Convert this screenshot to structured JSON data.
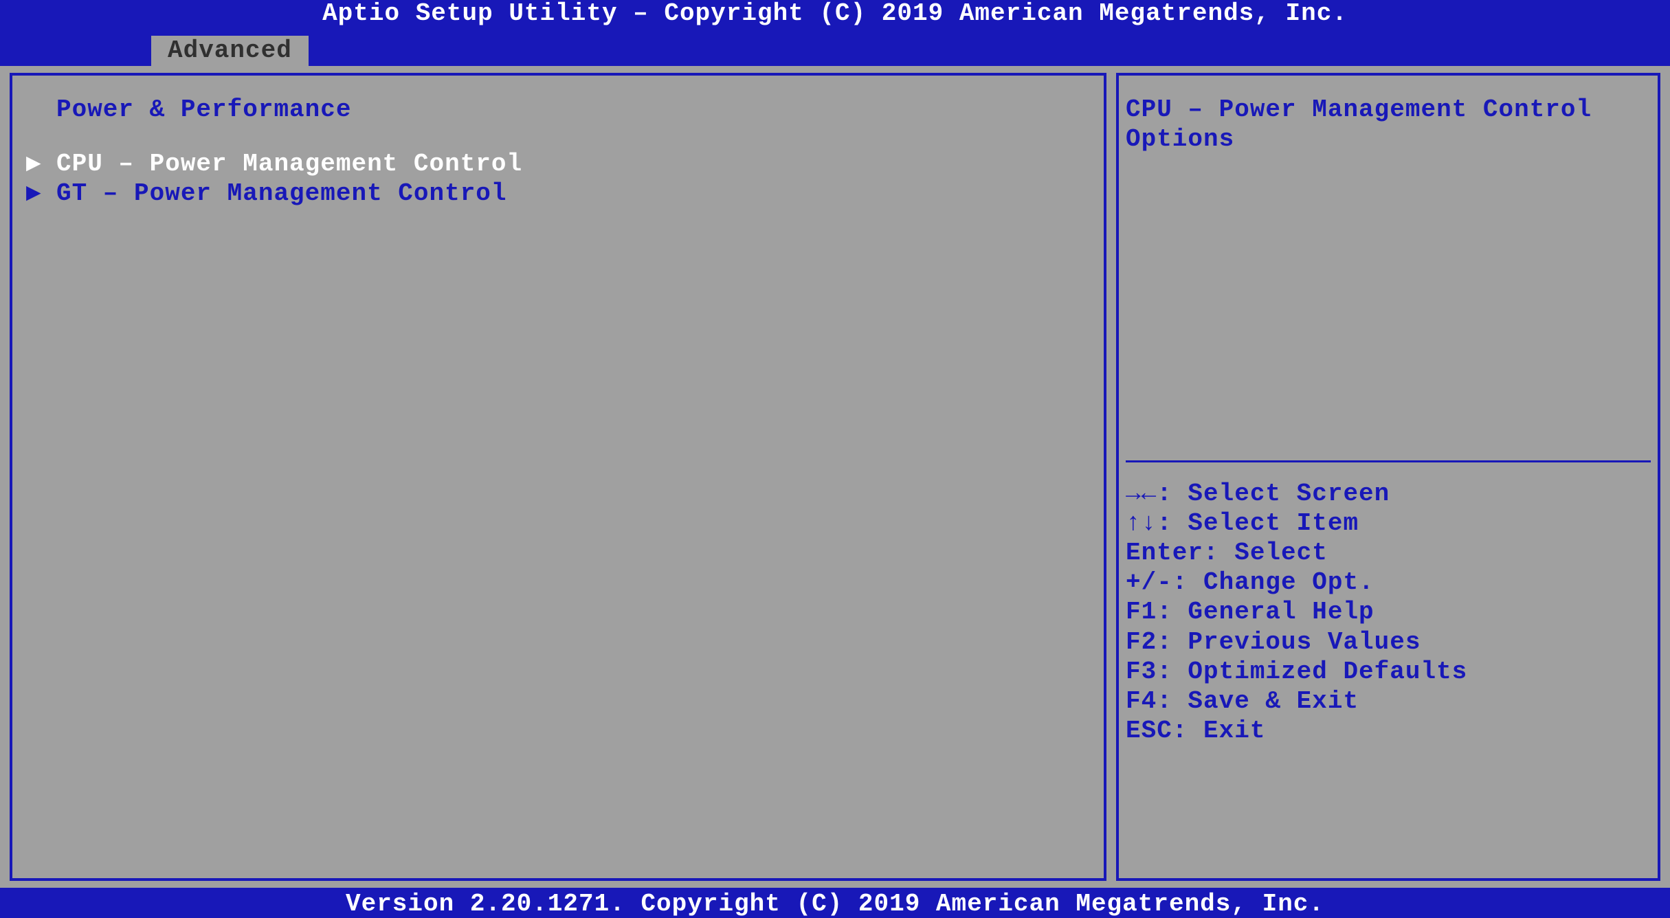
{
  "header": {
    "title": "Aptio Setup Utility – Copyright (C) 2019 American Megatrends, Inc."
  },
  "tabs": {
    "active": "Advanced"
  },
  "content": {
    "title": "Power & Performance",
    "items": [
      {
        "label": "CPU – Power Management Control",
        "selected": true
      },
      {
        "label": "GT – Power Management Control",
        "selected": false
      }
    ]
  },
  "help": {
    "description_line1": "CPU – Power Management Control",
    "description_line2": "Options",
    "keys": {
      "select_screen": "→←: Select Screen",
      "select_item": "↑↓: Select Item",
      "select": "Enter: Select",
      "change_opt": "+/-: Change Opt.",
      "general_help": "F1: General Help",
      "prev_values": "F2: Previous Values",
      "opt_defaults": "F3: Optimized Defaults",
      "save_exit": "F4: Save & Exit",
      "exit": "ESC: Exit"
    }
  },
  "footer": {
    "text": "Version 2.20.1271. Copyright (C) 2019 American Megatrends, Inc."
  }
}
